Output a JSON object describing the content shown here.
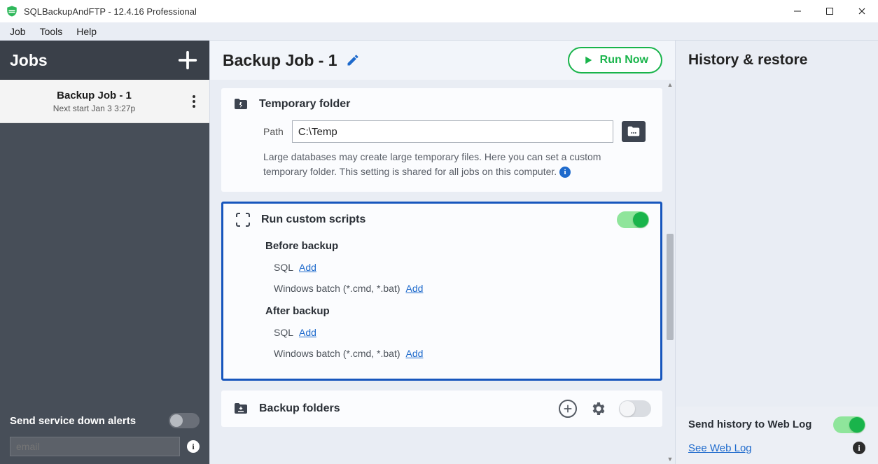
{
  "titlebar": {
    "text": "SQLBackupAndFTP - 12.4.16 Professional"
  },
  "menu": {
    "job": "Job",
    "tools": "Tools",
    "help": "Help"
  },
  "sidebar": {
    "header": "Jobs",
    "job": {
      "title": "Backup Job - 1",
      "sub": "Next start Jan 3 3:27p"
    },
    "alerts_label": "Send service down alerts",
    "email_placeholder": "email"
  },
  "center": {
    "title": "Backup Job - 1",
    "run": "Run Now",
    "temp": {
      "title": "Temporary folder",
      "path_label": "Path",
      "path_value": "C:\\Temp",
      "help": "Large databases may create large temporary files. Here you can set a custom temporary folder. This setting is shared for all jobs on this computer."
    },
    "scripts": {
      "title": "Run custom scripts",
      "before_label": "Before backup",
      "after_label": "After backup",
      "sql_label": "SQL",
      "batch_label": "Windows batch (*.cmd, *.bat)",
      "add": "Add"
    },
    "folders": {
      "title": "Backup folders"
    }
  },
  "right": {
    "header": "History & restore",
    "send_title": "Send history to Web Log",
    "see": "See Web Log"
  }
}
